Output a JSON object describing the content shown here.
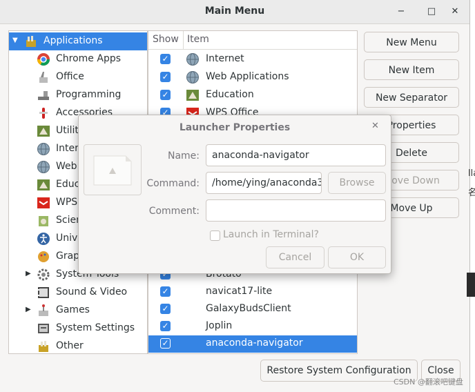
{
  "window": {
    "title": "Main Menu",
    "minimize_glyph": "−",
    "maximize_glyph": "□",
    "close_glyph": "✕"
  },
  "tree": {
    "items": [
      {
        "label": "Applications",
        "icon": "applications-icon",
        "expander": "▼",
        "selected": true
      },
      {
        "label": "Chrome Apps",
        "icon": "chrome-icon"
      },
      {
        "label": "Office",
        "icon": "office-icon"
      },
      {
        "label": "Programming",
        "icon": "programming-icon"
      },
      {
        "label": "Accessories",
        "icon": "accessories-icon"
      },
      {
        "label": "Utilities",
        "icon": "utilities-icon"
      },
      {
        "label": "Internet",
        "icon": "globe-icon"
      },
      {
        "label": "Web Applications",
        "icon": "globe-icon"
      },
      {
        "label": "Education",
        "icon": "education-icon"
      },
      {
        "label": "WPS Office",
        "icon": "wps-icon"
      },
      {
        "label": "Science",
        "icon": "science-icon"
      },
      {
        "label": "Universal Access",
        "icon": "accessibility-icon"
      },
      {
        "label": "Graphics",
        "icon": "graphics-icon"
      },
      {
        "label": "System Tools",
        "icon": "gear-icon",
        "expander": "▶"
      },
      {
        "label": "Sound & Video",
        "icon": "film-icon"
      },
      {
        "label": "Games",
        "icon": "games-icon",
        "expander": "▶"
      },
      {
        "label": "System Settings",
        "icon": "settings-icon"
      },
      {
        "label": "Other",
        "icon": "other-icon"
      }
    ]
  },
  "list": {
    "headers": {
      "show": "Show",
      "item": "Item"
    },
    "check_glyph": "✓",
    "items": [
      {
        "label": "Internet",
        "icon": "globe-icon"
      },
      {
        "label": "Web Applications",
        "icon": "globe-icon"
      },
      {
        "label": "Education",
        "icon": "education-icon"
      },
      {
        "label": "WPS Office",
        "icon": "wps-icon"
      },
      {
        "label": "Brotato"
      },
      {
        "label": "navicat17-lite"
      },
      {
        "label": "GalaxyBudsClient"
      },
      {
        "label": "Joplin"
      },
      {
        "label": "anaconda-navigator",
        "selected": true
      }
    ]
  },
  "buttons": {
    "new_menu": "New Menu",
    "new_item": "New Item",
    "new_separator": "New Separator",
    "properties": "Properties",
    "delete": "Delete",
    "move_down": "Move Down",
    "move_up": "Move Up",
    "restore": "Restore System Configuration",
    "close": "Close"
  },
  "dialog": {
    "title": "Launcher Properties",
    "close_glyph": "✕",
    "name_label": "Name:",
    "name_value": "anaconda-navigator",
    "command_label": "Command:",
    "command_value": "/home/ying/anaconda3",
    "browse": "Browse",
    "comment_label": "Comment:",
    "comment_value": "",
    "launch_terminal": "Launch in Terminal?",
    "cancel": "Cancel",
    "ok": "OK"
  },
  "background": {
    "fragment_1": "lla",
    "fragment_2": "名",
    "watermark": "CSDN @翻滚吧键盘"
  },
  "colors": {
    "accent": "#3584e4"
  }
}
